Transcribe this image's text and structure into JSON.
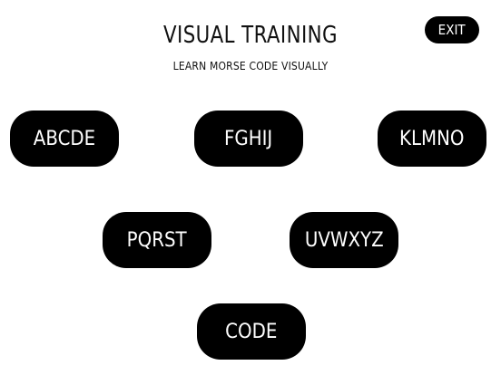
{
  "header": {
    "title": "VISUAL TRAINING",
    "subtitle": "LEARN MORSE CODE VISUALLY",
    "exit_label": "EXIT"
  },
  "buttons": [
    {
      "label": "ABCDE"
    },
    {
      "label": "FGHIJ"
    },
    {
      "label": "KLMNO"
    },
    {
      "label": "PQRST"
    },
    {
      "label": "UVWXYZ"
    },
    {
      "label": "CODE"
    }
  ],
  "colors": {
    "background": "#ffffff",
    "button": "#000000",
    "button_text": "#ffffff",
    "text": "#111111"
  }
}
